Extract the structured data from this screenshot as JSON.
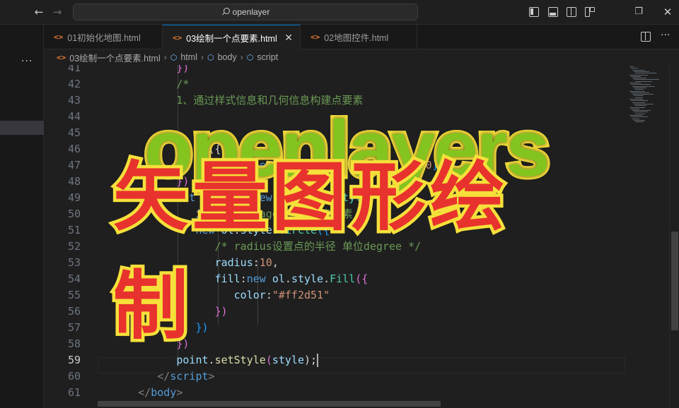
{
  "titlebar": {
    "search_text": "openlayer"
  },
  "tabs": [
    {
      "label": "01初始化地图.html"
    },
    {
      "label": "03绘制一个点要素.html"
    },
    {
      "label": "02地图控件.html"
    }
  ],
  "breadcrumb": {
    "file": "03绘制一个点要素.html",
    "items": [
      "html",
      "body",
      "script"
    ]
  },
  "editor": {
    "active_line": 59,
    "lines": [
      {
        "n": "41",
        "tokens": [
          {
            "t": "            ",
            "c": "c-punc"
          },
          {
            "t": "})",
            "c": "c-brace"
          }
        ]
      },
      {
        "n": "42",
        "tokens": [
          {
            "t": "            /*",
            "c": "c-comment"
          }
        ]
      },
      {
        "n": "43",
        "tokens": [
          {
            "t": "            1、通过样式信息和几何信息构建点要素",
            "c": "c-comment"
          }
        ]
      },
      {
        "n": "44",
        "tokens": [
          {
            "t": "            ",
            "c": "c-comment"
          }
        ]
      },
      {
        "n": "45",
        "tokens": [
          {
            "t": "            ",
            "c": "c-punc"
          }
        ]
      },
      {
        "n": "46",
        "tokens": [
          {
            "t": "               ",
            "c": "c-punc"
          },
          {
            "t": "re({",
            "c": "c-punc"
          }
        ]
      },
      {
        "n": "47",
        "tokens": [
          {
            "t": "               ",
            "c": "c-punc"
          },
          {
            "t": "geometry",
            "c": "c-var"
          },
          {
            "t": ":",
            "c": "c-punc"
          },
          {
            "t": "new ",
            "c": "c-kw"
          },
          {
            "t": "ol",
            "c": "c-var"
          },
          {
            "t": ".",
            "c": "c-punc"
          },
          {
            "t": "geom",
            "c": "c-var"
          },
          {
            "t": ".",
            "c": "c-punc"
          },
          {
            "t": "Point",
            "c": "c-cls"
          },
          {
            "t": "([",
            "c": "c-brace2"
          },
          {
            "t": "114",
            "c": "c-str"
          },
          {
            "t": ",",
            "c": "c-punc"
          },
          {
            "t": "30.50",
            "c": "c-str"
          },
          {
            "t": "])",
            "c": "c-brace2"
          }
        ]
      },
      {
        "n": "48",
        "tokens": [
          {
            "t": "            ",
            "c": "c-punc"
          },
          {
            "t": "})",
            "c": "c-brace"
          }
        ]
      },
      {
        "n": "49",
        "tokens": [
          {
            "t": "            ",
            "c": "c-punc"
          },
          {
            "t": "let ",
            "c": "c-kw"
          },
          {
            "t": "style",
            "c": "c-var"
          },
          {
            "t": " = ",
            "c": "c-punc"
          },
          {
            "t": "new ",
            "c": "c-kw"
          },
          {
            "t": "ol",
            "c": "c-var"
          },
          {
            "t": ".",
            "c": "c-punc"
          },
          {
            "t": "style",
            "c": "c-var"
          },
          {
            "t": ".",
            "c": "c-punc"
          },
          {
            "t": "Style",
            "c": "c-cls"
          },
          {
            "t": "({",
            "c": "c-brace"
          }
        ]
      },
      {
        "n": "50",
        "tokens": [
          {
            "t": "               ",
            "c": "c-punc"
          },
          {
            "t": "image",
            "c": "c-var"
          },
          {
            "t": ":",
            "c": "c-punc"
          },
          {
            "t": "//image属性设置点要素",
            "c": "c-comment"
          }
        ]
      },
      {
        "n": "51",
        "tokens": [
          {
            "t": "               ",
            "c": "c-punc"
          },
          {
            "t": "new ",
            "c": "c-kw"
          },
          {
            "t": "ol",
            "c": "c-var"
          },
          {
            "t": ".",
            "c": "c-punc"
          },
          {
            "t": "style",
            "c": "c-var"
          },
          {
            "t": ".",
            "c": "c-punc"
          },
          {
            "t": "Circle",
            "c": "c-cls"
          },
          {
            "t": "({",
            "c": "c-brace2"
          }
        ]
      },
      {
        "n": "52",
        "tokens": [
          {
            "t": "                  ",
            "c": "c-punc"
          },
          {
            "t": "/* radius设置点的半径 单位degree */",
            "c": "c-comment"
          }
        ]
      },
      {
        "n": "53",
        "tokens": [
          {
            "t": "                  ",
            "c": "c-punc"
          },
          {
            "t": "radius",
            "c": "c-var"
          },
          {
            "t": ":",
            "c": "c-punc"
          },
          {
            "t": "10",
            "c": "c-str"
          },
          {
            "t": ",",
            "c": "c-punc"
          }
        ]
      },
      {
        "n": "54",
        "tokens": [
          {
            "t": "                  ",
            "c": "c-punc"
          },
          {
            "t": "fill",
            "c": "c-var"
          },
          {
            "t": ":",
            "c": "c-punc"
          },
          {
            "t": "new ",
            "c": "c-kw"
          },
          {
            "t": "ol",
            "c": "c-var"
          },
          {
            "t": ".",
            "c": "c-punc"
          },
          {
            "t": "style",
            "c": "c-var"
          },
          {
            "t": ".",
            "c": "c-punc"
          },
          {
            "t": "Fill",
            "c": "c-cls"
          },
          {
            "t": "({",
            "c": "c-brace"
          }
        ]
      },
      {
        "n": "55",
        "tokens": [
          {
            "t": "                     ",
            "c": "c-punc"
          },
          {
            "t": "color",
            "c": "c-var"
          },
          {
            "t": ":",
            "c": "c-punc"
          },
          {
            "t": "\"#ff2d51\"",
            "c": "c-str"
          }
        ]
      },
      {
        "n": "56",
        "tokens": [
          {
            "t": "                  ",
            "c": "c-punc"
          },
          {
            "t": "})",
            "c": "c-brace"
          }
        ]
      },
      {
        "n": "57",
        "tokens": [
          {
            "t": "               ",
            "c": "c-punc"
          },
          {
            "t": "})",
            "c": "c-brace2"
          }
        ]
      },
      {
        "n": "58",
        "tokens": [
          {
            "t": "            ",
            "c": "c-punc"
          },
          {
            "t": "})",
            "c": "c-brace"
          }
        ]
      },
      {
        "n": "59",
        "tokens": [
          {
            "t": "            ",
            "c": "c-punc"
          },
          {
            "t": "point",
            "c": "c-var"
          },
          {
            "t": ".",
            "c": "c-punc"
          },
          {
            "t": "setStyle",
            "c": "c-fn"
          },
          {
            "t": "(",
            "c": "c-brace"
          },
          {
            "t": "style",
            "c": "c-var"
          },
          {
            "t": ");",
            "c": "c-punc"
          }
        ]
      },
      {
        "n": "60",
        "tokens": [
          {
            "t": "         ",
            "c": "c-punc"
          },
          {
            "t": "</",
            "c": "c-tag"
          },
          {
            "t": "script",
            "c": "c-tagname"
          },
          {
            "t": ">",
            "c": "c-tag"
          }
        ]
      },
      {
        "n": "61",
        "tokens": [
          {
            "t": "      ",
            "c": "c-punc"
          },
          {
            "t": "</",
            "c": "c-tag"
          },
          {
            "t": "body",
            "c": "c-tagname"
          },
          {
            "t": ">",
            "c": "c-tag"
          }
        ]
      }
    ]
  },
  "overlay": {
    "title": "openlayers",
    "subtitle": "矢量图形绘制",
    "title_color": "#84c41f",
    "subtitle_color": "#e8322d",
    "stroke_color": "#f6e03a"
  },
  "colors": {
    "accent": "#0078d4",
    "html_icon": "#e37933"
  }
}
